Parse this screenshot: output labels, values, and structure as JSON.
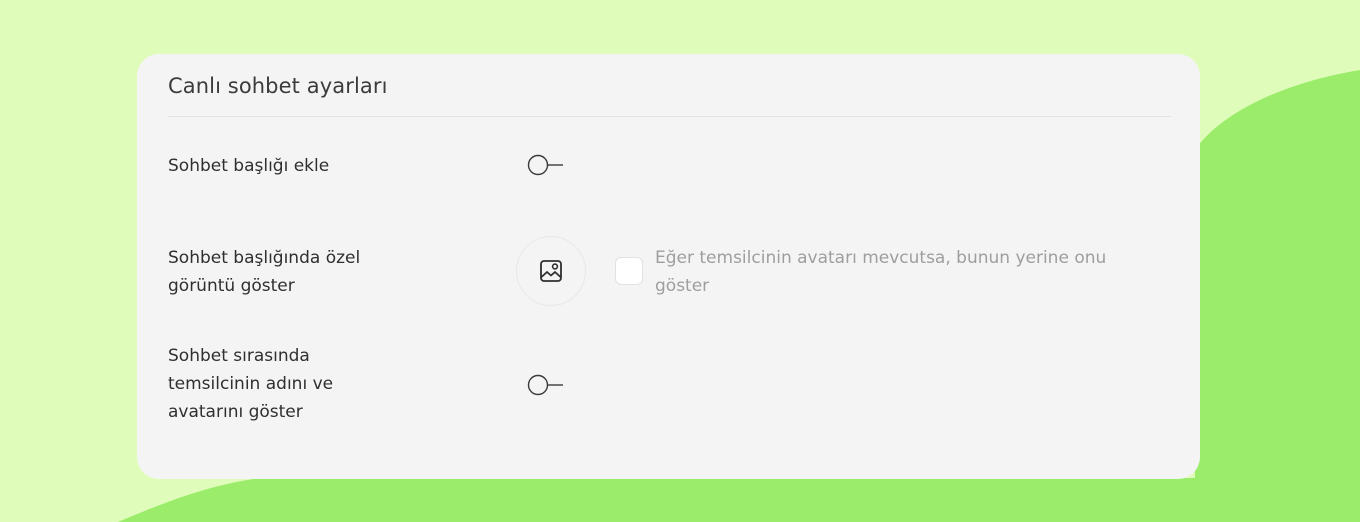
{
  "colors": {
    "page_background": "#dffcba",
    "accent_blob": "#9aec6a",
    "card_background": "#f4f4f4"
  },
  "card": {
    "title": "Canlı sohbet ayarları"
  },
  "settings": [
    {
      "label": "Sohbet başlığı ekle",
      "control": "toggle",
      "enabled": false
    },
    {
      "label": "Sohbet başlığında özel görüntü göster",
      "control": "image-picker",
      "icon": "image-icon",
      "checkbox": {
        "label": "Eğer temsilcinin avatarı mevcutsa, bunun yerine onu göster",
        "checked": false
      }
    },
    {
      "label": "Sohbet sırasında temsilcinin adını ve avatarını göster",
      "control": "toggle",
      "enabled": false
    }
  ]
}
